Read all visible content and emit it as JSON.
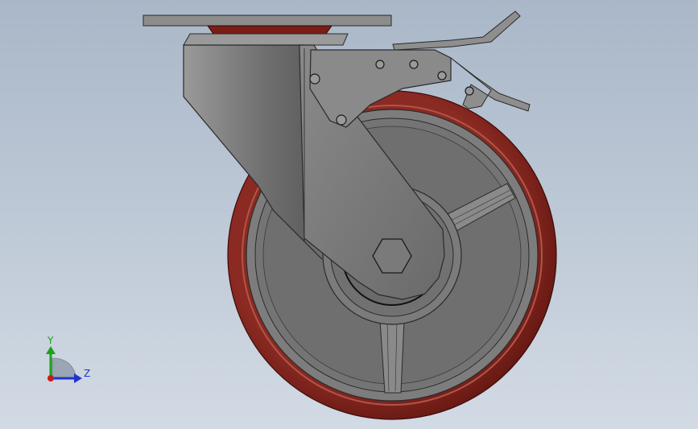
{
  "viewport": {
    "background_top": "#a9b7c8",
    "background_bottom": "#d2dae4"
  },
  "model": {
    "wheel_tread_color": "#6e1a14",
    "wheel_tread_highlight": "#a8453c",
    "hub_color": "#7a7a7a",
    "bracket_color": "#7c7c7c",
    "plate_color": "#8a8a8a"
  },
  "triad": {
    "y_label": "Y",
    "z_label": "Z",
    "y_color": "#1aa31a",
    "z_color": "#2233cc",
    "x_color": "#cc1a1a"
  }
}
